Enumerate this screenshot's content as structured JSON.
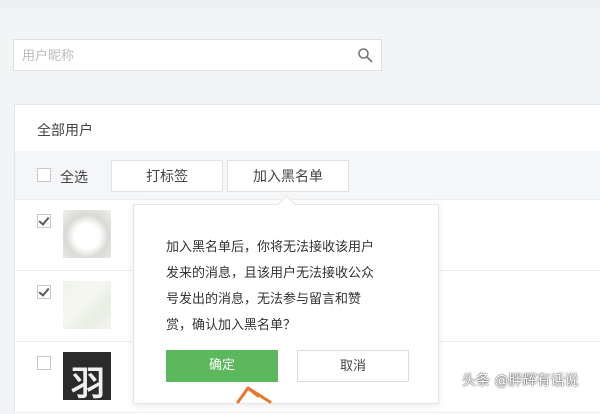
{
  "search": {
    "placeholder": "用户昵称",
    "value": "",
    "icon": "search-icon"
  },
  "panel": {
    "title": "全部用户"
  },
  "toolbar": {
    "select_all_label": "全选",
    "select_all_checked": false,
    "tag_button_label": "打标签",
    "blacklist_button_label": "加入黑名单"
  },
  "rows": [
    {
      "checked": true,
      "avatar": "avatar-white-dog"
    },
    {
      "checked": true,
      "avatar": "avatar-light-pattern"
    },
    {
      "checked": false,
      "avatar": "avatar-dark-calligraphy",
      "avatar_glyph": "羽"
    }
  ],
  "popover": {
    "lines": [
      "加入黑名单后，你将无法接收该用户",
      "发来的消息，且该用户无法接收公众",
      "号发出的消息，无法参与留言和赞",
      "赏，确认加入黑名单？"
    ],
    "confirm_label": "确定",
    "cancel_label": "取消"
  },
  "colors": {
    "confirm_green": "#5cb85c",
    "cursor_orange": "#e8772e"
  },
  "watermark": "头条 @胖辉有话说"
}
